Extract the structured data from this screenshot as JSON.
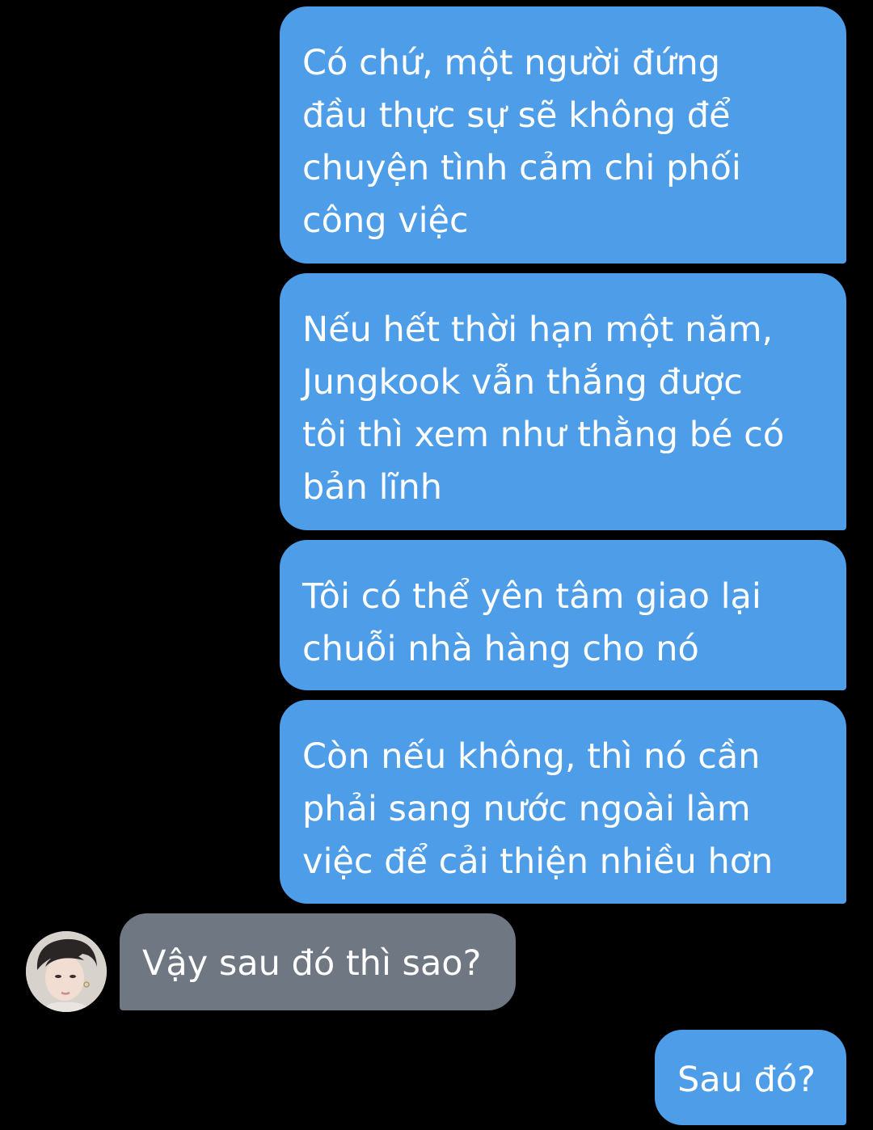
{
  "conversation": {
    "messages": [
      {
        "sender": "me",
        "lines": [
          "Có chứ, một người đứng",
          "đầu thực sự sẽ không để",
          "chuyện tình cảm chi phối",
          "công việc"
        ]
      },
      {
        "sender": "me",
        "lines": [
          "Nếu hết thời hạn một năm,",
          "Jungkook vẫn thắng được",
          "tôi thì xem như thằng bé có",
          "bản lĩnh"
        ]
      },
      {
        "sender": "me",
        "lines": [
          "Tôi có thể yên tâm giao lại",
          "chuỗi nhà hàng cho nó"
        ]
      },
      {
        "sender": "me",
        "lines": [
          "Còn nếu không, thì nó cần",
          "phải sang nước ngoài làm",
          "việc để cải thiện nhiều hơn"
        ]
      },
      {
        "sender": "other",
        "lines": [
          "Vậy sau đó thì sao?"
        ],
        "avatar_icon": "contact-avatar-photo"
      },
      {
        "sender": "me",
        "lines": [
          "Sau đó?"
        ]
      }
    ]
  },
  "colors": {
    "background": "#000000",
    "sent_bubble": "#4e9de8",
    "received_bubble": "#6e7782",
    "text": "#ffffff"
  }
}
